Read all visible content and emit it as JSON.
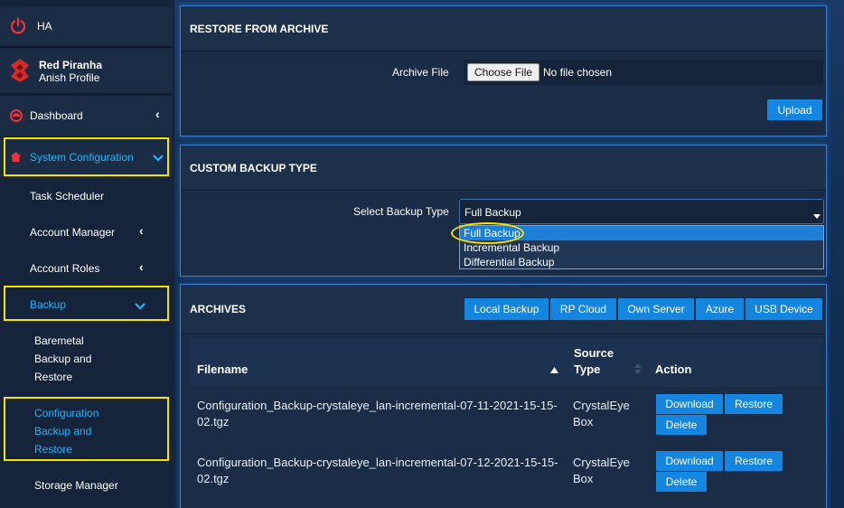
{
  "sidebar": {
    "ha_label": "HA",
    "profile_name": "Red Piranha",
    "profile_sub": "Anish Profile",
    "items": {
      "dashboard": "Dashboard",
      "system_configuration": "System Configuration",
      "task_scheduler": "Task Scheduler",
      "account_manager": "Account Manager",
      "account_roles": "Account Roles",
      "backup": "Backup",
      "baremetal_1": "Baremetal",
      "baremetal_2": "Backup and",
      "baremetal_3": "Restore",
      "config_1": "Configuration",
      "config_2": "Backup and",
      "config_3": "Restore",
      "storage_manager": "Storage Manager"
    }
  },
  "restore": {
    "title": "RESTORE FROM ARCHIVE",
    "archive_label": "Archive File",
    "choose_button": "Choose File",
    "no_file": "No file chosen",
    "upload_button": "Upload"
  },
  "custom": {
    "title": "CUSTOM BACKUP TYPE",
    "select_label": "Select Backup Type",
    "selected": "Full Backup",
    "options": [
      "Full Backup",
      "Incremental Backup",
      "Differential Backup"
    ]
  },
  "archives": {
    "title": "ARCHIVES",
    "tabs": [
      "Local Backup",
      "RP Cloud",
      "Own Server",
      "Azure",
      "USB Device"
    ],
    "columns": {
      "filename": "Filename",
      "source_1": "Source",
      "source_2": "Type",
      "action": "Action"
    },
    "rows": [
      {
        "file_1": "Configuration_Backup-crystaleye_lan-incremental-07-11-2021-15-15-",
        "file_2": "02.tgz",
        "source_1": "CrystalEye",
        "source_2": "Box",
        "download": "Download",
        "restore": "Restore",
        "delete": "Delete"
      },
      {
        "file_1": "Configuration_Backup-crystaleye_lan-incremental-07-12-2021-15-15-",
        "file_2": "02.tgz",
        "source_1": "CrystalEye",
        "source_2": "Box",
        "download": "Download",
        "restore": "Restore",
        "delete": "Delete"
      }
    ]
  },
  "colors": {
    "accent": "#1486e0",
    "highlight": "#f5e400",
    "active_text": "#1fb4ff",
    "brand_red": "#d42a2a"
  }
}
